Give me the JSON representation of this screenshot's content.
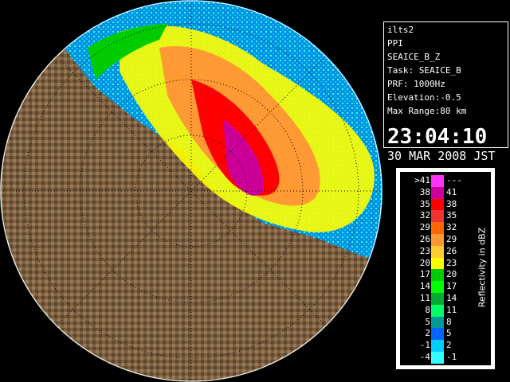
{
  "info": {
    "site": "ilts2",
    "scan": "PPI",
    "product": "SEAICE_B_Z",
    "task": "Task: SEAICE_B",
    "prf": "PRF: 1000Hz",
    "elevation": "Elevation:-0.5",
    "max_range": "Max Range:80 km",
    "time": "23:04:10",
    "date": "30 MAR 2008 JST"
  },
  "legend": {
    "title": "Reflectivity in dBZ",
    "rows": [
      {
        "left": ">41",
        "right": "---",
        "color": "#ff33ff"
      },
      {
        "left": "38",
        "right": "41",
        "color": "#cc0099"
      },
      {
        "left": "35",
        "right": "38",
        "color": "#ff0000"
      },
      {
        "left": "32",
        "right": "35",
        "color": "#ee3333"
      },
      {
        "left": "29",
        "right": "32",
        "color": "#ff6600"
      },
      {
        "left": "26",
        "right": "29",
        "color": "#ff9933"
      },
      {
        "left": "23",
        "right": "26",
        "color": "#ffcc33"
      },
      {
        "left": "20",
        "right": "23",
        "color": "#ffff00"
      },
      {
        "left": "17",
        "right": "20",
        "color": "#00cc00"
      },
      {
        "left": "14",
        "right": "17",
        "color": "#00ff00"
      },
      {
        "left": "11",
        "right": "14",
        "color": "#00aa33"
      },
      {
        "left": "8",
        "right": "11",
        "color": "#00ff66"
      },
      {
        "left": "5",
        "right": "8",
        "color": "#009999"
      },
      {
        "left": "2",
        "right": "5",
        "color": "#0066ff"
      },
      {
        "left": "-1",
        "right": "2",
        "color": "#00ccff"
      },
      {
        "left": "-4",
        "right": "-1",
        "color": "#33ffff"
      }
    ]
  }
}
